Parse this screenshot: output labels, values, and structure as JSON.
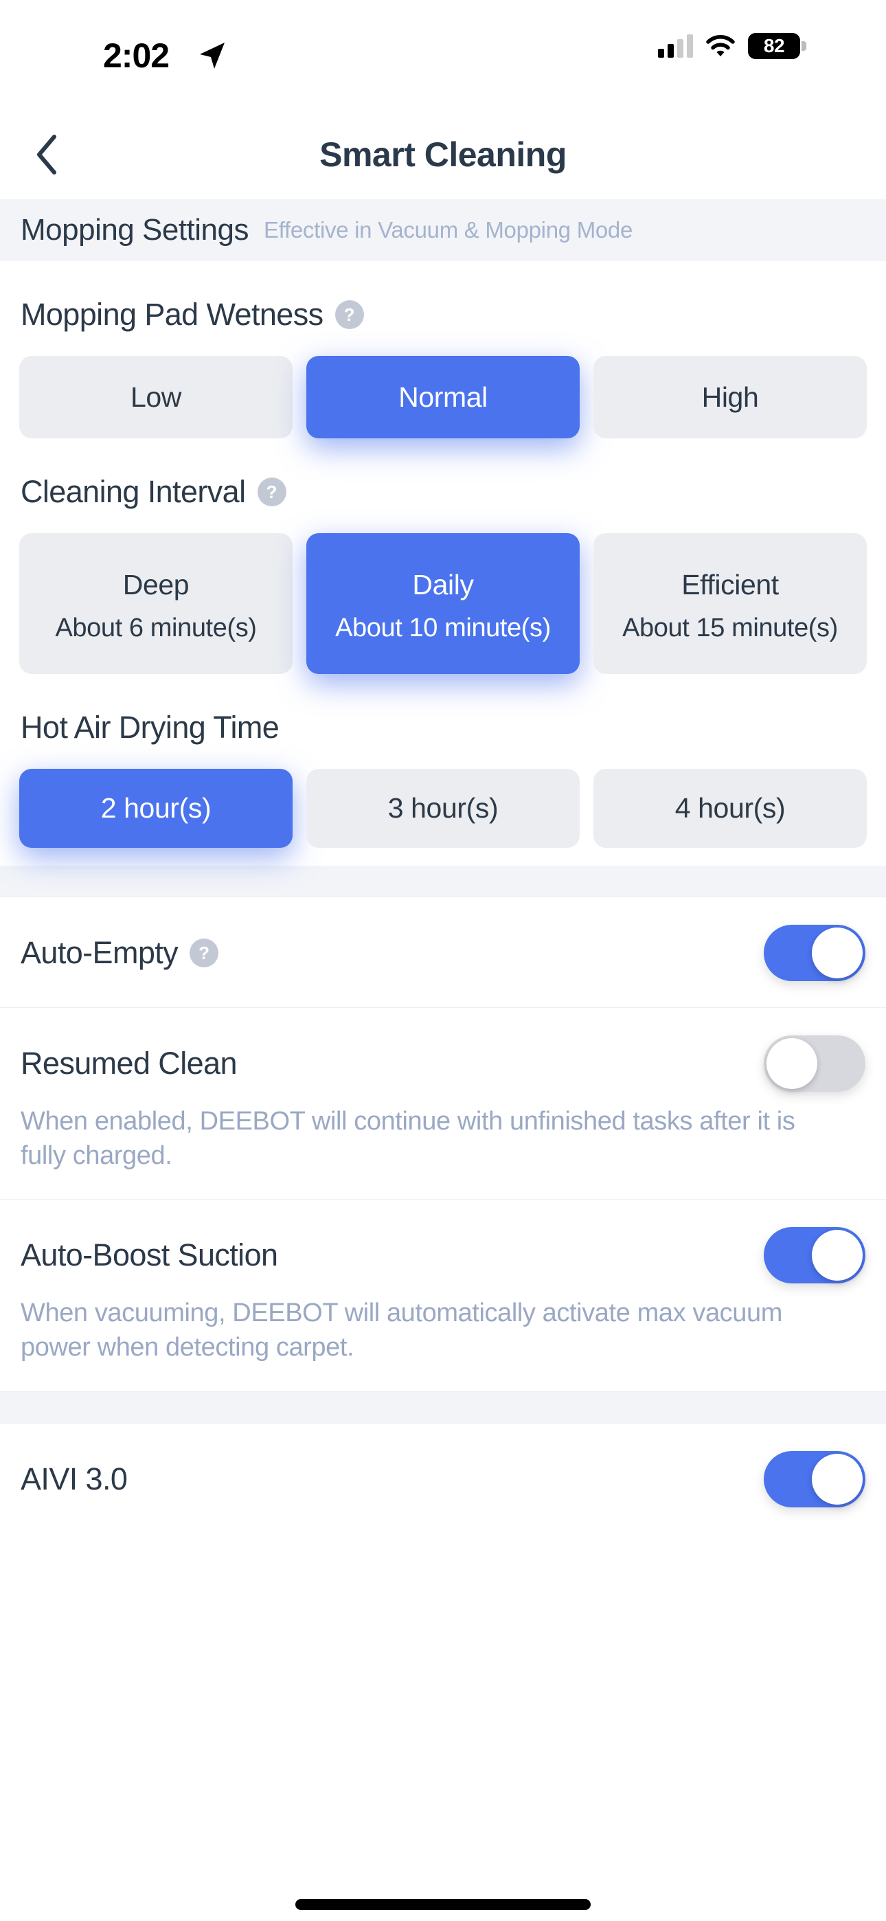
{
  "status_bar": {
    "time": "2:02",
    "battery_level": "82",
    "location_icon": "location-arrow-icon",
    "signal_icon": "cellular-signal-icon",
    "wifi_icon": "wifi-icon"
  },
  "nav": {
    "back_icon": "chevron-left-icon",
    "title": "Smart Cleaning"
  },
  "mopping_band": {
    "title": "Mopping Settings",
    "subtitle": "Effective in Vacuum & Mopping Mode"
  },
  "groups": [
    {
      "title": "Mopping Pad Wetness",
      "help_icon": "question-mark-icon",
      "has_help": true,
      "options": [
        {
          "label": "Low",
          "sub": "",
          "selected": false
        },
        {
          "label": "Normal",
          "sub": "",
          "selected": true
        },
        {
          "label": "High",
          "sub": "",
          "selected": false
        }
      ]
    },
    {
      "title": "Cleaning Interval",
      "help_icon": "question-mark-icon",
      "has_help": true,
      "options": [
        {
          "label": "Deep",
          "sub": "About 6 minute(s)",
          "selected": false
        },
        {
          "label": "Daily",
          "sub": "About 10 minute(s)",
          "selected": true
        },
        {
          "label": "Efficient",
          "sub": "About 15 minute(s)",
          "selected": false
        }
      ]
    },
    {
      "title": "Hot Air Drying Time",
      "help_icon": "",
      "has_help": false,
      "options": [
        {
          "label": "2 hour(s)",
          "sub": "",
          "selected": true
        },
        {
          "label": "3 hour(s)",
          "sub": "",
          "selected": false
        },
        {
          "label": "4 hour(s)",
          "sub": "",
          "selected": false
        }
      ]
    }
  ],
  "toggle_rows": [
    {
      "title": "Auto-Empty",
      "has_help": true,
      "help_icon": "question-mark-icon",
      "desc": "",
      "on": true
    },
    {
      "title": "Resumed Clean",
      "has_help": false,
      "help_icon": "",
      "desc": "When enabled, DEEBOT will continue with unfinished tasks after it is fully charged.",
      "on": false
    },
    {
      "title": "Auto-Boost Suction",
      "has_help": false,
      "help_icon": "",
      "desc": "When vacuuming, DEEBOT will automatically activate max vacuum power when detecting carpet.",
      "on": true
    }
  ],
  "bottom_row": {
    "title": "AIVI 3.0",
    "on": true
  },
  "colors": {
    "accent": "#4a73ed",
    "pill_bg": "#ebedf0",
    "heading": "#2c3948",
    "muted": "#9aa8c4",
    "band_bg": "#f2f4f8",
    "toggle_off": "#d6d8dd"
  }
}
